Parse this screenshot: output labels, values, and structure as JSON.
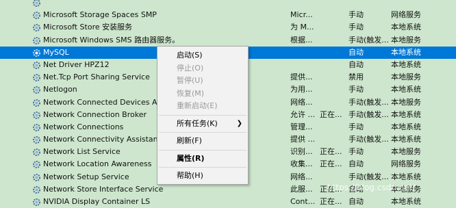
{
  "services": [
    {
      "name": "",
      "desc": "",
      "status": "",
      "startup": "",
      "logon": ""
    },
    {
      "name": "Microsoft Storage Spaces SMP",
      "desc": "Micr...",
      "status": "",
      "startup": "手动",
      "logon": "网络服务"
    },
    {
      "name": "Microsoft Store 安装服务",
      "desc": "为 M...",
      "status": "",
      "startup": "手动",
      "logon": "本地系统"
    },
    {
      "name": "Microsoft Windows SMS 路由器服务。",
      "desc": "根据...",
      "status": "",
      "startup": "手动(触发...",
      "logon": "本地服务"
    },
    {
      "name": "MySQL",
      "desc": "",
      "status": "",
      "startup": "自动",
      "logon": "本地系统"
    },
    {
      "name": "Net Driver HPZ12",
      "desc": "",
      "status": "",
      "startup": "自动",
      "logon": "本地系统"
    },
    {
      "name": "Net.Tcp Port Sharing Service",
      "desc": "提供...",
      "status": "",
      "startup": "禁用",
      "logon": "本地服务"
    },
    {
      "name": "Netlogon",
      "desc": "为用...",
      "status": "",
      "startup": "手动",
      "logon": "本地系统"
    },
    {
      "name": "Network Connected Devices Auto-Setup",
      "desc": "网络...",
      "status": "",
      "startup": "手动(触发...",
      "logon": "本地服务"
    },
    {
      "name": "Network Connection Broker",
      "desc": "允许 ...",
      "status": "正在...",
      "startup": "手动(触发...",
      "logon": "本地系统"
    },
    {
      "name": "Network Connections",
      "desc": "管理...",
      "status": "",
      "startup": "手动",
      "logon": "本地系统"
    },
    {
      "name": "Network Connectivity Assistant",
      "desc": "提供 ...",
      "status": "",
      "startup": "手动(触发...",
      "logon": "本地系统"
    },
    {
      "name": "Network List Service",
      "desc": "识别...",
      "status": "正在...",
      "startup": "手动",
      "logon": "本地服务"
    },
    {
      "name": "Network Location Awareness",
      "desc": "收集...",
      "status": "正在...",
      "startup": "自动",
      "logon": "网络服务"
    },
    {
      "name": "Network Setup Service",
      "desc": "网络...",
      "status": "",
      "startup": "手动(触发...",
      "logon": "本地系统"
    },
    {
      "name": "Network Store Interface Service",
      "desc": "此服...",
      "status": "正在...",
      "startup": "自动",
      "logon": "本地服务"
    },
    {
      "name": "NVIDIA Display Container LS",
      "desc": "Cont...",
      "status": "正在...",
      "startup": "自动",
      "logon": "本地系统"
    }
  ],
  "menu": {
    "start": "启动(S)",
    "stop": "停止(O)",
    "pause": "暂停(U)",
    "resume": "恢复(M)",
    "restart": "重新启动(E)",
    "all_tasks": "所有任务(K)",
    "refresh": "刷新(F)",
    "properties": "属性(R)",
    "help": "帮助(H)"
  },
  "watermark": "https://blog.csdn.net/",
  "colors": {
    "background": "#cde6cd",
    "selection": "#0078d7"
  },
  "icon": "gear-icon"
}
